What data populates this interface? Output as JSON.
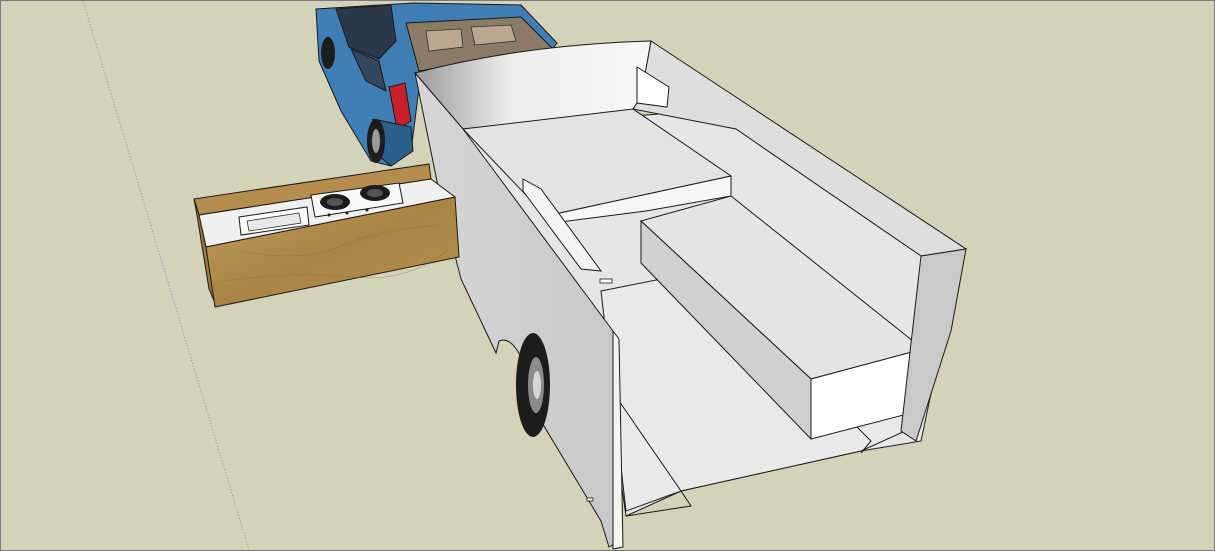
{
  "colors": {
    "ground": "#d4d2b8",
    "axis_line": "#a9a9c8",
    "car_body": "#3f7fb6",
    "car_dark": "#2d5f8c",
    "car_glass": "#2b3a4a",
    "tail_light": "#c8202a",
    "trailer_white": "#f2f2f2",
    "trailer_shade": "#cfcfcf",
    "trailer_dark": "#b8b8b8",
    "edge": "#1a1a1a",
    "wood": "#b48d4e",
    "wood_dark": "#8e6a33",
    "tire": "#1c1c1c"
  },
  "icons": {
    "model_axis": "axis-line-icon",
    "car": "car-icon",
    "trailer": "trailer-icon",
    "kitchen_drawer": "kitchen-module-icon",
    "stove": "stove-burner-icon",
    "sink": "sink-icon",
    "wheel": "wheel-icon"
  }
}
